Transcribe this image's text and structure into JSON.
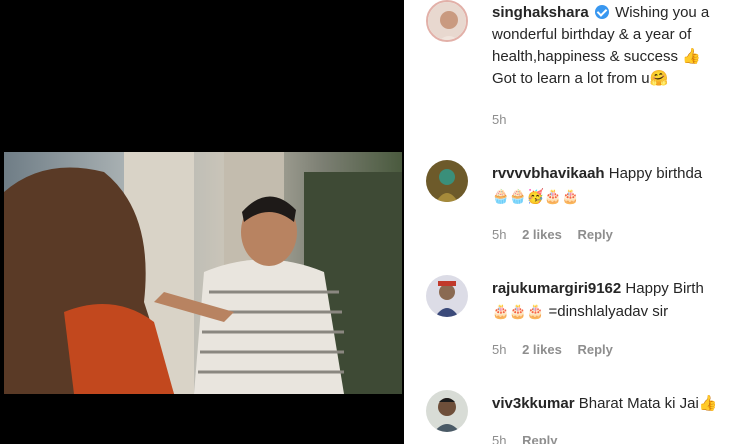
{
  "video": {
    "label": "video-player"
  },
  "comments": [
    {
      "username": "singhakshara",
      "verified": true,
      "lines": [
        "Wishing you a",
        "wonderful birthday & a year of",
        "health,happiness & success 👍",
        "Got to learn a lot from u🤗"
      ],
      "time": "5h",
      "likes": "",
      "reply": ""
    },
    {
      "username": "rvvvvbhavikaah",
      "text": "Happy birthda",
      "emojis": "🧁🧁🥳🎂🎂",
      "time": "5h",
      "likes": "2 likes",
      "reply": "Reply"
    },
    {
      "username": "rajukumargiri9162",
      "text": "Happy Birth",
      "line2_emojis": "🎂🎂🎂",
      "line2_text": "=dinshlalyadav sir",
      "time": "5h",
      "likes": "2 likes",
      "reply": "Reply"
    },
    {
      "username": "viv3kkumar",
      "text": "Bharat Mata ki Jai👍",
      "time": "5h",
      "reply": "Reply"
    }
  ],
  "colors": {
    "verified": "#3897f0",
    "meta": "#8e8e8e",
    "text": "#262626"
  }
}
